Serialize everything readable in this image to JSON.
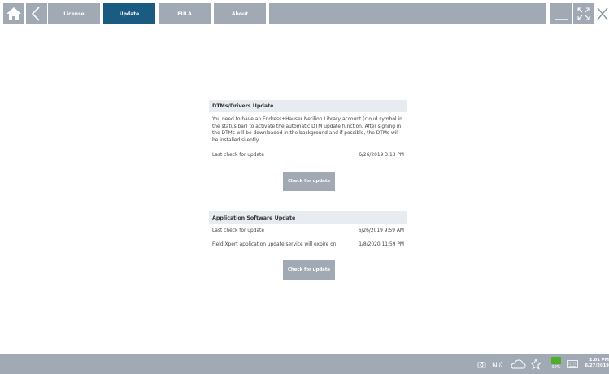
{
  "toolbar": {
    "tabs": [
      "License",
      "Update",
      "EULA",
      "About"
    ],
    "active_tab": "Update"
  },
  "dtm_section": {
    "title": "DTMs/Drivers Update",
    "description": "You need to have an Endress+Hauser Netilion Library account (cloud symbol in the status bar) to activate the automatic DTM update function. After signing in, the DTMs will be downloaded in the background and if possible, the DTMs will be installed silently.",
    "last_check_label": "Last check for update",
    "last_check_value": "6/26/2019 3:13 PM",
    "button_label": "Check for update"
  },
  "app_section": {
    "title": "Application Software Update",
    "last_check_label": "Last check for update",
    "last_check_value": "6/26/2019 9:59 AM",
    "expire_label": "Field Xpert application update service will expire on",
    "expire_value": "1/8/2020 11:59 PM",
    "button_label": "Check for update"
  },
  "statusbar": {
    "battery_percent": "99%",
    "time": "1:01 PM",
    "date": "6/27/2019"
  },
  "colors": {
    "toolbar_button": "#a1aab4",
    "active_tab": "#1a5b82",
    "section_header": "#e8ecf0"
  }
}
